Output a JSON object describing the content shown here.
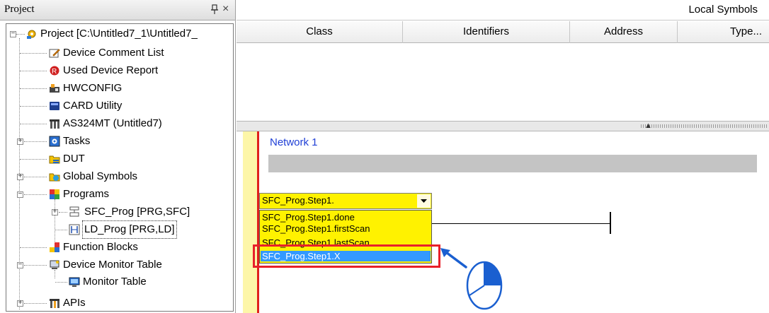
{
  "project_panel": {
    "title": "Project",
    "close_symbol": "×",
    "tree": [
      {
        "label": "Project [C:\\Untitled7_1\\Untitled7_",
        "icon": "project-gear-icon",
        "expander": "−"
      },
      {
        "label": "Device Comment List",
        "icon": "comment-edit-icon"
      },
      {
        "label": "Used Device Report",
        "icon": "report-icon"
      },
      {
        "label": "HWCONFIG",
        "icon": "hardware-config-icon"
      },
      {
        "label": "CARD Utility",
        "icon": "card-icon"
      },
      {
        "label": "AS324MT  (Untitled7)",
        "icon": "plc-module-icon"
      },
      {
        "label": "Tasks",
        "icon": "tasks-icon",
        "expander": "+"
      },
      {
        "label": "DUT",
        "icon": "dut-icon"
      },
      {
        "label": "Global Symbols",
        "icon": "global-symbols-icon",
        "expander": "+"
      },
      {
        "label": "Programs",
        "icon": "programs-icon",
        "expander": "−"
      },
      {
        "label": "SFC_Prog [PRG,SFC]",
        "icon": "sfc-program-icon",
        "expander": "+"
      },
      {
        "label": "LD_Prog [PRG,LD]",
        "icon": "ld-program-icon"
      },
      {
        "label": "Function Blocks",
        "icon": "function-blocks-icon"
      },
      {
        "label": "Device Monitor Table",
        "icon": "device-monitor-icon",
        "expander": "−"
      },
      {
        "label": "Monitor Table",
        "icon": "monitor-table-icon"
      },
      {
        "label": "APIs",
        "icon": "apis-icon",
        "expander": "+"
      }
    ]
  },
  "local_symbols": {
    "title": "Local Symbols",
    "columns": [
      "Class",
      "Identifiers",
      "Address",
      "Type..."
    ]
  },
  "ladder": {
    "network_label": "Network 1",
    "combo_value": "SFC_Prog.Step1.",
    "dropdown_items": [
      "SFC_Prog.Step1.done",
      "SFC_Prog.Step1.firstScan",
      "SFC_Prog.Step1.lastScan",
      "SFC_Prog.Step1.X"
    ],
    "selected_item": "SFC_Prog.Step1.X"
  },
  "colors": {
    "highlight_box": "#e8202a",
    "selection": "#3399ff",
    "editor_yellow": "#fff200",
    "network_label": "#1f3fd6",
    "annotation_blue": "#1a5fd0"
  }
}
